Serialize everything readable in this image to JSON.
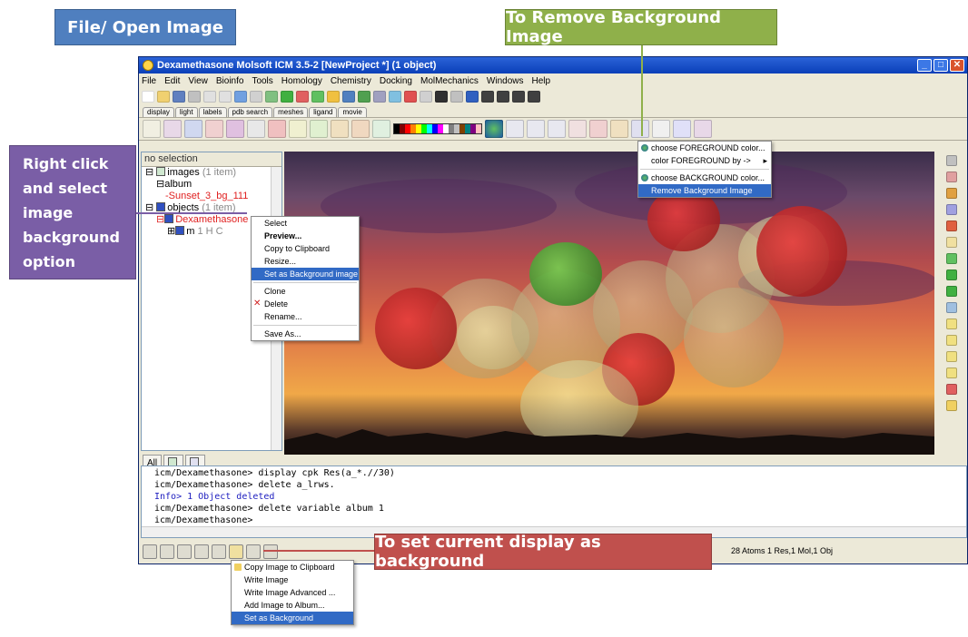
{
  "callouts": {
    "file_open": "File/ Open Image",
    "remove_bg": "To Remove Background Image",
    "right_click": [
      "Right click",
      "and select",
      "image",
      "background",
      "option"
    ],
    "set_current": "To set current display as background"
  },
  "window": {
    "title": "Dexamethasone Molsoft ICM 3.5-2 [NewProject *] (1 object)",
    "menus": [
      "File",
      "Edit",
      "View",
      "Bioinfo",
      "Tools",
      "Homology",
      "Chemistry",
      "Docking",
      "MolMechanics",
      "Windows",
      "Help"
    ],
    "tabs": [
      "display",
      "light",
      "labels",
      "pdb search",
      "meshes",
      "ligand",
      "movie"
    ]
  },
  "left_panel": {
    "header": "no selection",
    "tree": [
      {
        "label": "images",
        "count": "(1 item)"
      },
      {
        "label": "album"
      },
      {
        "label": "Sunset_3_bg_111"
      },
      {
        "label": "objects",
        "count": "(1 item)"
      },
      {
        "label": "Dexamethasone"
      },
      {
        "label": "m",
        "detail": "1 H C"
      }
    ],
    "tabs": [
      "All"
    ]
  },
  "context_menu": [
    "Select",
    "Preview...",
    "Copy to Clipboard",
    "Resize...",
    "Set as Background image",
    "Clone",
    "Delete",
    "Rename...",
    "Save As..."
  ],
  "color_menu": [
    "choose FOREGROUND color...",
    "color FOREGROUND by ->",
    "choose BACKGROUND color...",
    "Remove Background Image"
  ],
  "image_menu": [
    "Copy Image to Clipboard",
    "Write Image",
    "Write Image Advanced ...",
    "Add Image to Album...",
    "Set as Background"
  ],
  "console": [
    "icm/Dexamethasone> display cpk Res(a_*.//30)",
    "icm/Dexamethasone> delete a_lrws.",
    " Info> 1 Object deleted",
    "icm/Dexamethasone> delete variable album 1",
    "icm/Dexamethasone> "
  ],
  "status": "28 Atoms 1 Res,1 Mol,1 Obj"
}
